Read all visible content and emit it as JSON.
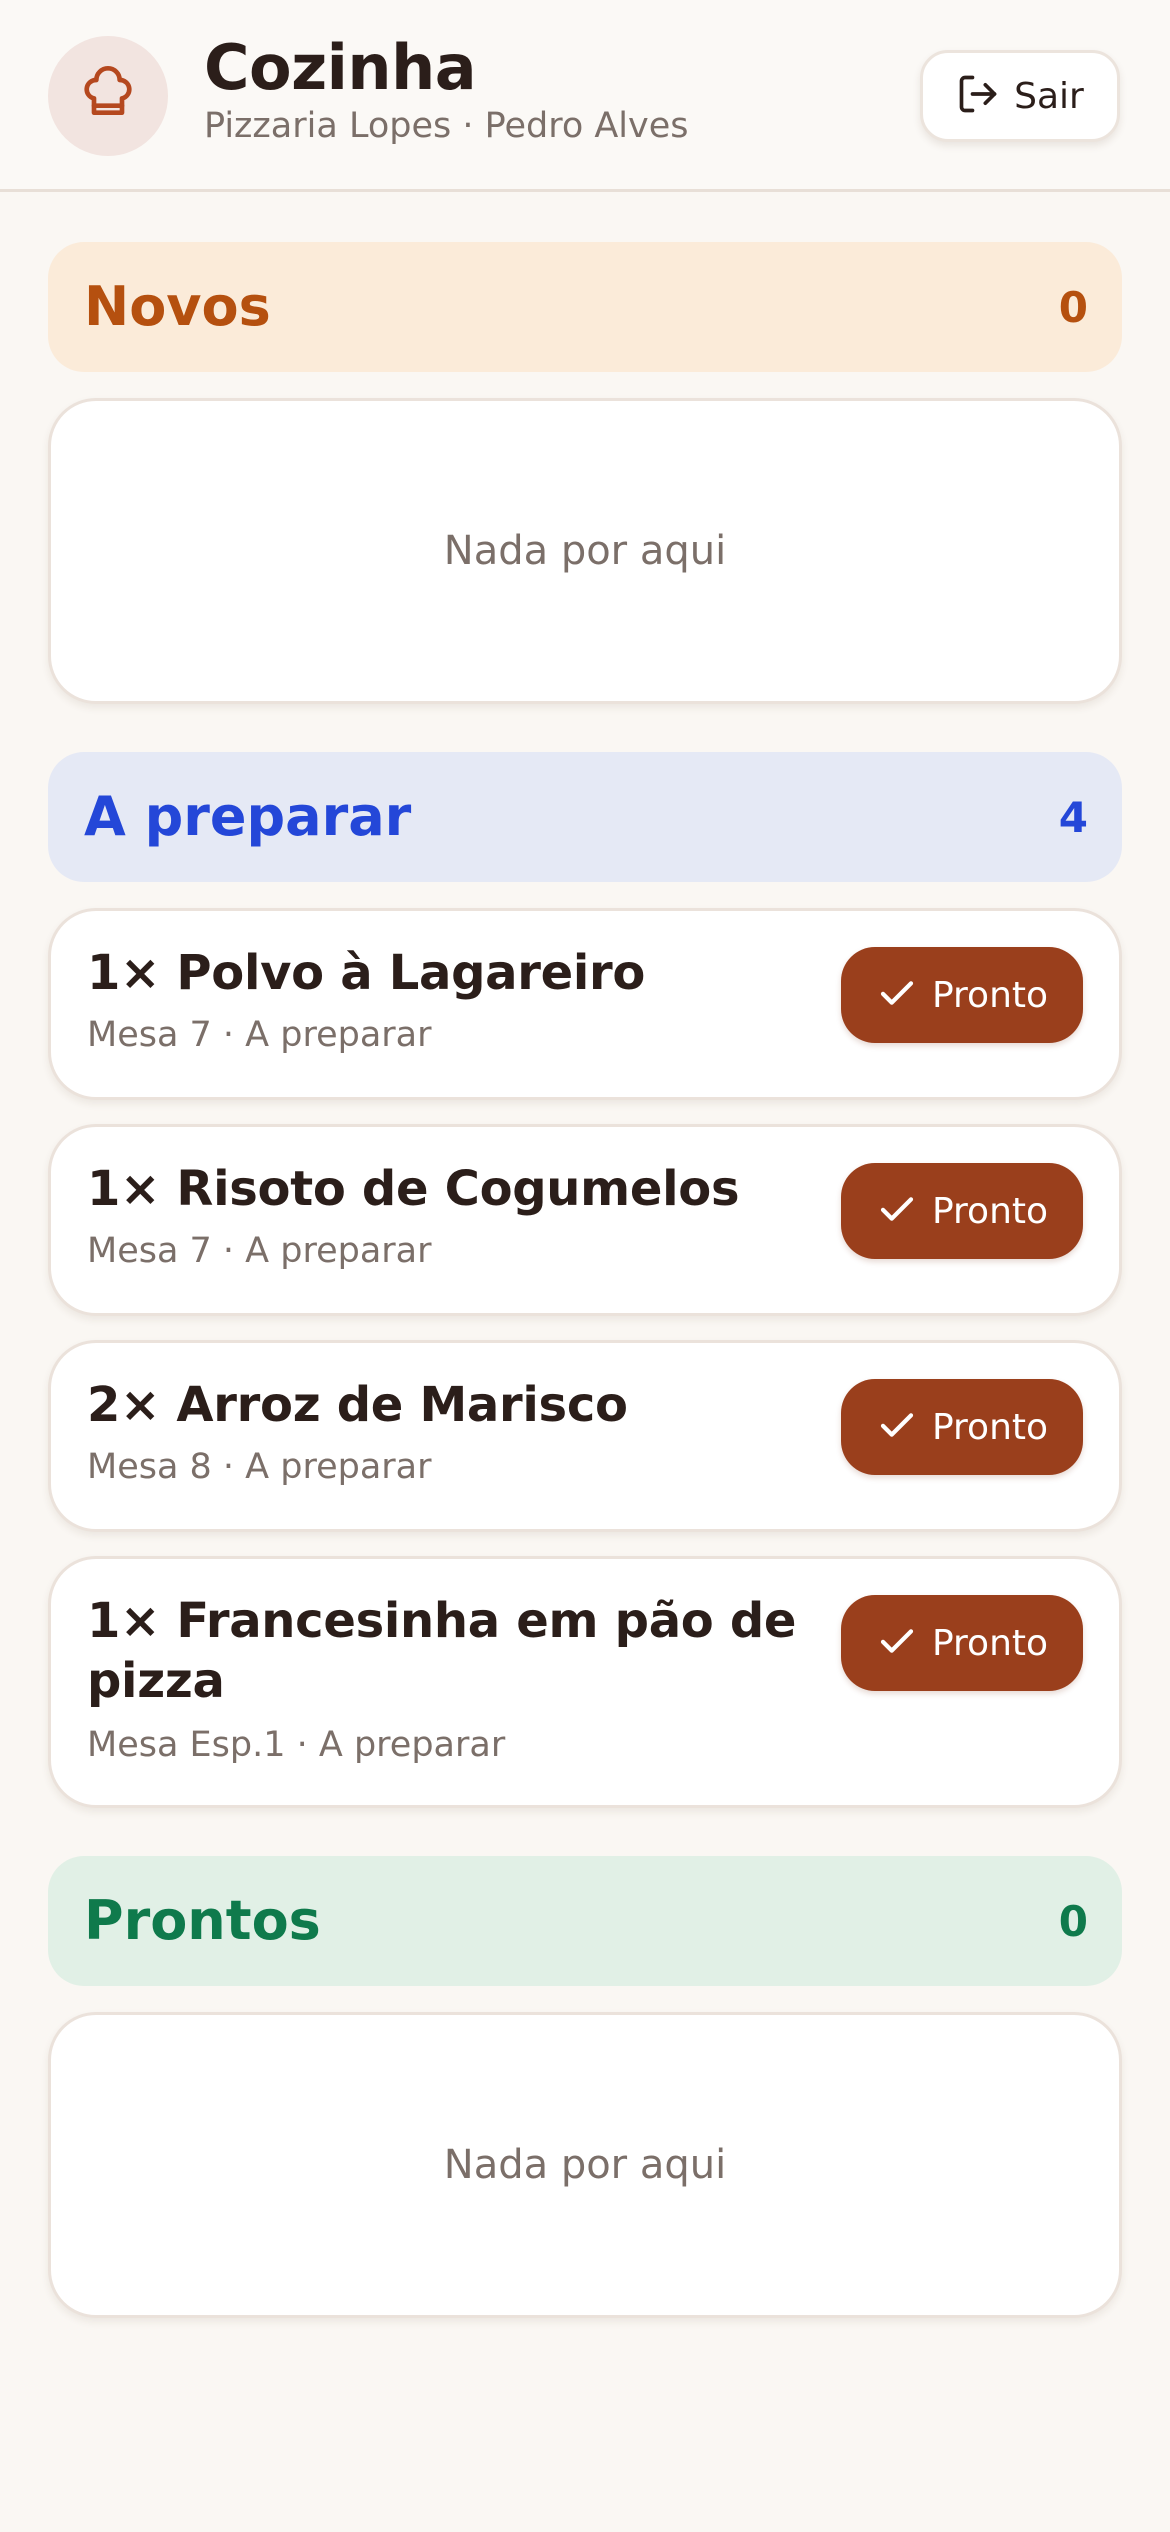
{
  "header": {
    "title": "Cozinha",
    "subtitle": "Pizzaria Lopes · Pedro Alves",
    "logout_label": "Sair",
    "avatar_icon": "chef-hat-icon",
    "logout_icon": "logout-icon"
  },
  "sections": {
    "novos": {
      "title": "Novos",
      "count": "0",
      "empty_text": "Nada por aqui",
      "color": "#b5500f",
      "bg": "#fbebd9"
    },
    "preparar": {
      "title": "A preparar",
      "count": "4",
      "color": "#2447d8",
      "bg": "#e5e9f5",
      "orders": [
        {
          "name": "1× Polvo à Lagareiro",
          "meta": "Mesa 7 · A preparar",
          "action": "Pronto"
        },
        {
          "name": "1× Risoto de Cogumelos",
          "meta": "Mesa 7 · A preparar",
          "action": "Pronto"
        },
        {
          "name": "2× Arroz de Marisco",
          "meta": "Mesa 8 · A preparar",
          "action": "Pronto"
        },
        {
          "name": "1× Francesinha em pão de pizza",
          "meta": "Mesa Esp.1 · A preparar",
          "action": "Pronto"
        }
      ]
    },
    "prontos": {
      "title": "Prontos",
      "count": "0",
      "empty_text": "Nada por aqui",
      "color": "#0f7a4c",
      "bg": "#e1f0e6"
    }
  },
  "colors": {
    "accent": "#9a3f1c",
    "background": "#faf7f3",
    "text": "#2b1e1a",
    "muted": "#7b6f69"
  }
}
